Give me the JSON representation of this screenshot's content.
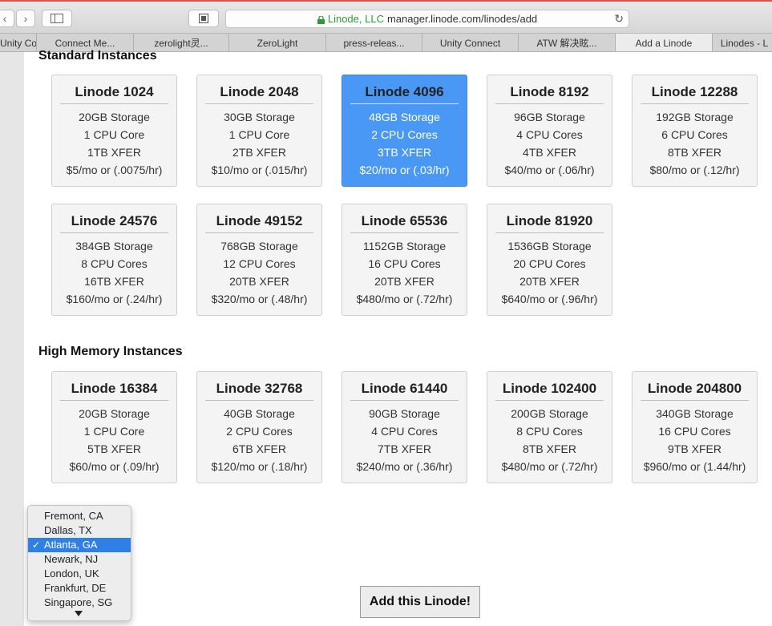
{
  "browser": {
    "url_secure_label": "Linode, LLC",
    "url": "manager.linode.com/linodes/add",
    "tabs": [
      {
        "label": "Unity Co",
        "active": false
      },
      {
        "label": "Connect Me...",
        "active": false
      },
      {
        "label": "zerolight灵...",
        "active": false
      },
      {
        "label": "ZeroLight",
        "active": false
      },
      {
        "label": "press-releas...",
        "active": false
      },
      {
        "label": "Unity Connect",
        "active": false
      },
      {
        "label": "ATW 解决眩...",
        "active": false
      },
      {
        "label": "Add a Linode",
        "active": true
      },
      {
        "label": "Linodes - L",
        "active": false
      }
    ]
  },
  "standard": {
    "title": "Standard Instances",
    "plans": [
      {
        "name": "Linode 1024",
        "storage": "20GB Storage",
        "cpu": "1 CPU Core",
        "xfer": "1TB XFER",
        "price": "$5/mo or (.0075/hr)"
      },
      {
        "name": "Linode 2048",
        "storage": "30GB Storage",
        "cpu": "1 CPU Core",
        "xfer": "2TB XFER",
        "price": "$10/mo or (.015/hr)"
      },
      {
        "name": "Linode 4096",
        "storage": "48GB Storage",
        "cpu": "2 CPU Cores",
        "xfer": "3TB XFER",
        "price": "$20/mo or (.03/hr)"
      },
      {
        "name": "Linode 8192",
        "storage": "96GB Storage",
        "cpu": "4 CPU Cores",
        "xfer": "4TB XFER",
        "price": "$40/mo or (.06/hr)"
      },
      {
        "name": "Linode 12288",
        "storage": "192GB Storage",
        "cpu": "6 CPU Cores",
        "xfer": "8TB XFER",
        "price": "$80/mo or (.12/hr)"
      },
      {
        "name": "Linode 24576",
        "storage": "384GB Storage",
        "cpu": "8 CPU Cores",
        "xfer": "16TB XFER",
        "price": "$160/mo or (.24/hr)"
      },
      {
        "name": "Linode 49152",
        "storage": "768GB Storage",
        "cpu": "12 CPU Cores",
        "xfer": "20TB XFER",
        "price": "$320/mo or (.48/hr)"
      },
      {
        "name": "Linode 65536",
        "storage": "1152GB Storage",
        "cpu": "16 CPU Cores",
        "xfer": "20TB XFER",
        "price": "$480/mo or (.72/hr)"
      },
      {
        "name": "Linode 81920",
        "storage": "1536GB Storage",
        "cpu": "20 CPU Cores",
        "xfer": "20TB XFER",
        "price": "$640/mo or (.96/hr)"
      }
    ]
  },
  "high_memory": {
    "title": "High Memory Instances",
    "plans": [
      {
        "name": "Linode 16384",
        "storage": "20GB Storage",
        "cpu": "1 CPU Core",
        "xfer": "5TB XFER",
        "price": "$60/mo or (.09/hr)"
      },
      {
        "name": "Linode 32768",
        "storage": "40GB Storage",
        "cpu": "2 CPU Cores",
        "xfer": "6TB XFER",
        "price": "$120/mo or (.18/hr)"
      },
      {
        "name": "Linode 61440",
        "storage": "90GB Storage",
        "cpu": "4 CPU Cores",
        "xfer": "7TB XFER",
        "price": "$240/mo or (.36/hr)"
      },
      {
        "name": "Linode 102400",
        "storage": "200GB Storage",
        "cpu": "8 CPU Cores",
        "xfer": "8TB XFER",
        "price": "$480/mo or (.72/hr)"
      },
      {
        "name": "Linode 204800",
        "storage": "340GB Storage",
        "cpu": "16 CPU Cores",
        "xfer": "9TB XFER",
        "price": "$960/mo or (1.44/hr)"
      }
    ]
  },
  "location": {
    "options": [
      {
        "label": "Fremont, CA",
        "selected": false
      },
      {
        "label": "Dallas, TX",
        "selected": false
      },
      {
        "label": "Atlanta, GA",
        "selected": true
      },
      {
        "label": "Newark, NJ",
        "selected": false
      },
      {
        "label": "London, UK",
        "selected": false
      },
      {
        "label": "Frankfurt, DE",
        "selected": false
      },
      {
        "label": "Singapore, SG",
        "selected": false
      }
    ],
    "checkmark": "✓"
  },
  "submit_label": "Add this Linode!",
  "colors": {
    "selected_card": "#4a98f6",
    "selected_option": "#2f7fe8",
    "secure_green": "#2e9b3a"
  }
}
